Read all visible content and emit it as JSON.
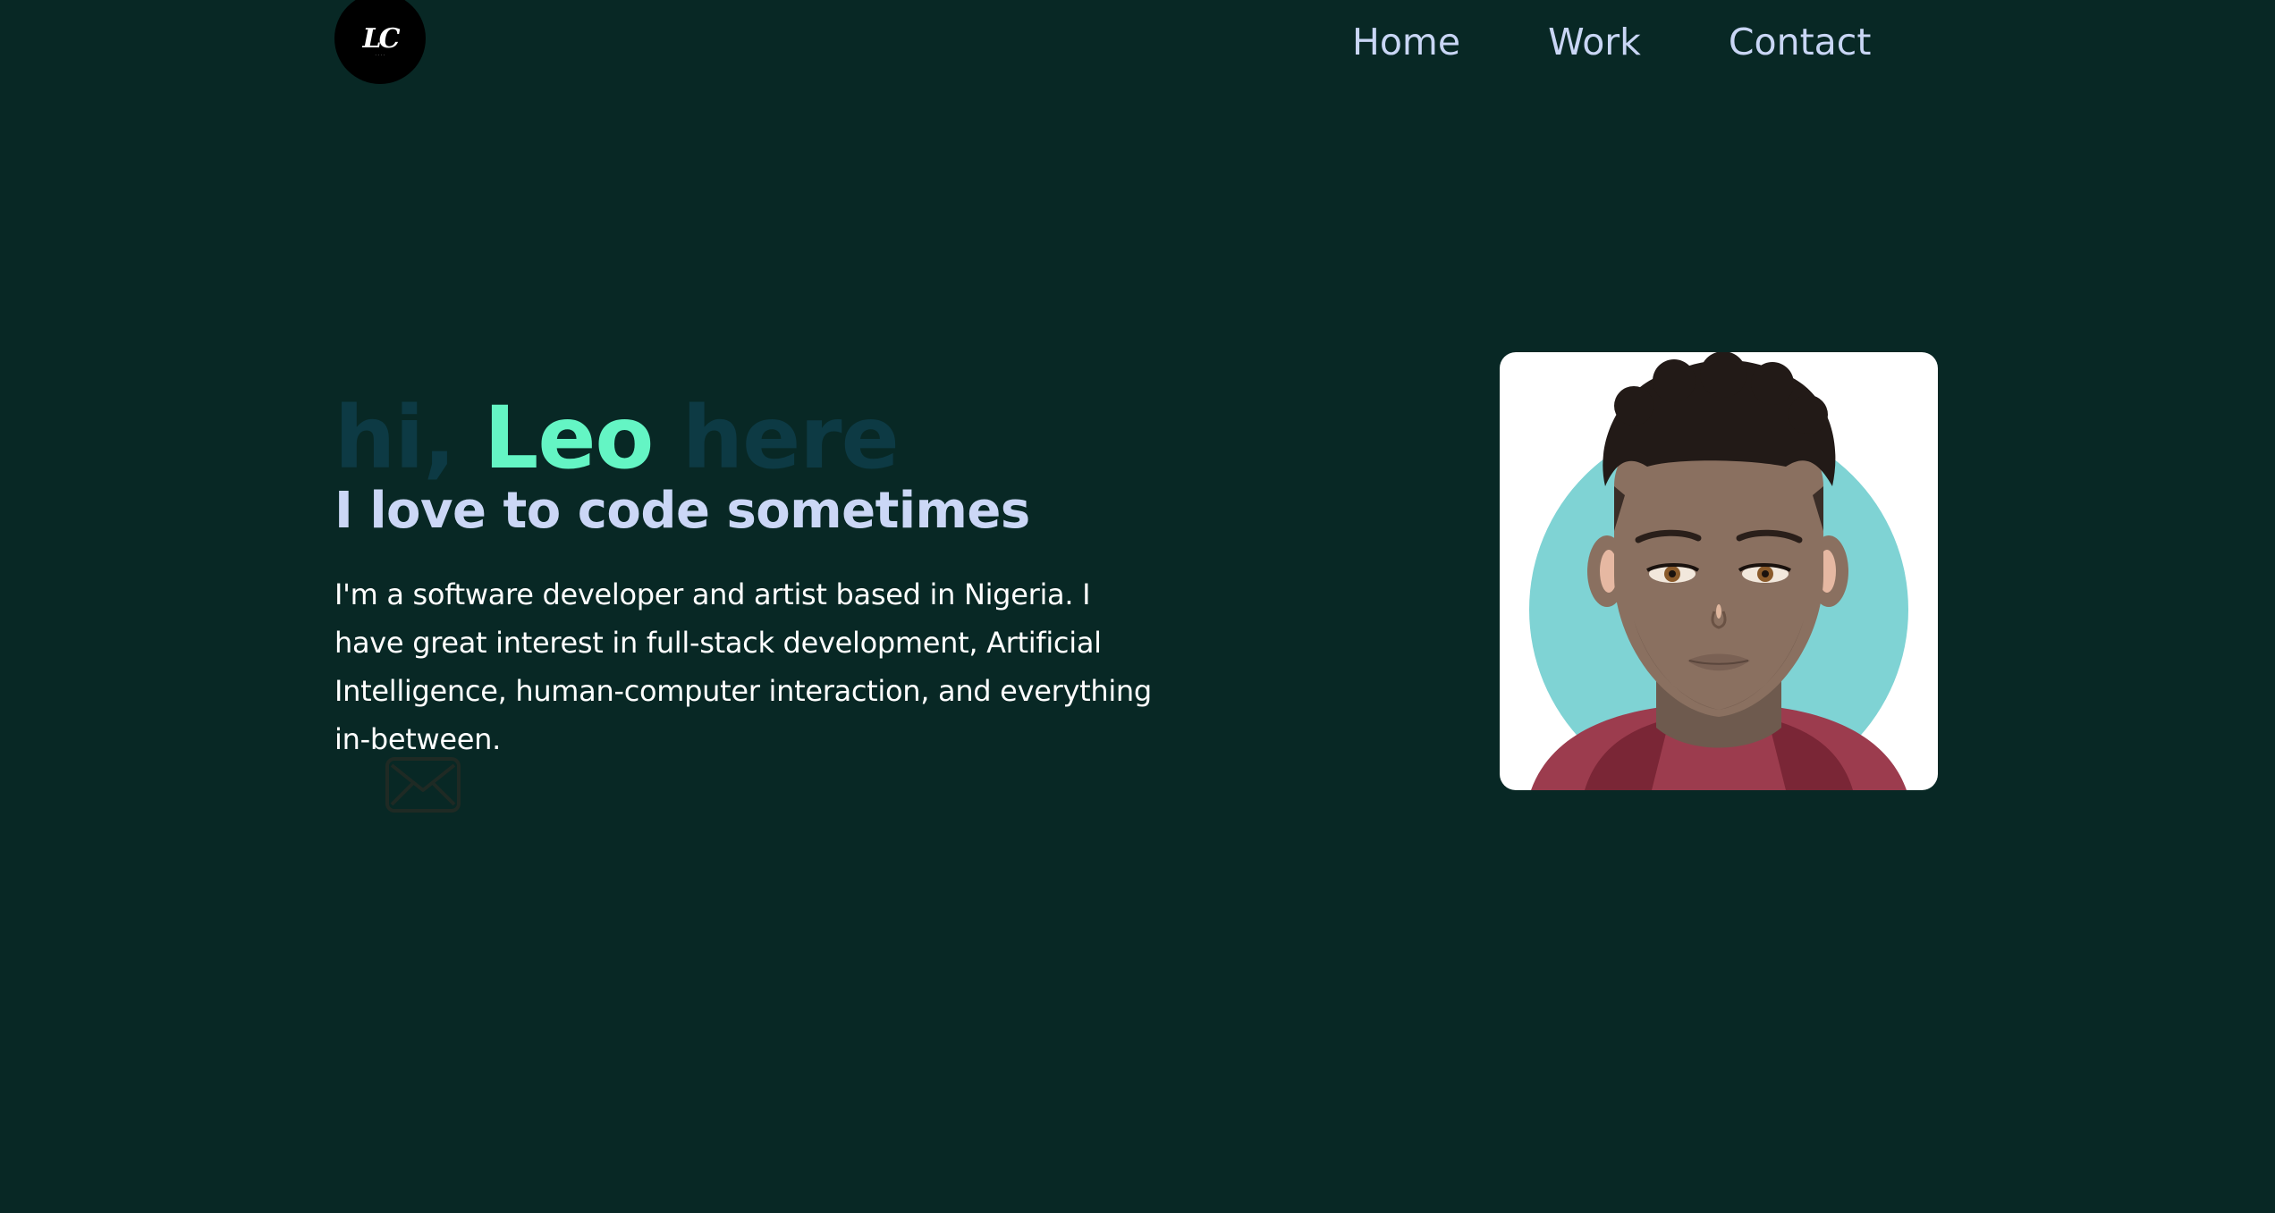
{
  "header": {
    "logo": {
      "mark": "LC",
      "icon": "logo-mark"
    },
    "nav": [
      {
        "label": "Home"
      },
      {
        "label": "Work"
      },
      {
        "label": "Contact"
      }
    ]
  },
  "hero": {
    "greeting_prefix": "hi, ",
    "name": "Leo",
    "greeting_suffix": " here",
    "tagline": "I love to code sometimes",
    "description": "I'm a software developer and artist based in Nigeria. I have great interest in full-stack development, Artificial Intelligence, human-computer interaction, and everything in-between.",
    "contact_icon": "envelope-icon"
  },
  "avatar": {
    "icon": "avatar-illustration"
  },
  "colors": {
    "background": "#082825",
    "accent": "#64f5c4",
    "dim_text": "#0d3a44",
    "nav_text": "#c9d6f5",
    "tagline": "#cbd7f6",
    "body_text": "#ffffff",
    "avatar_circle": "#7fd3d4",
    "hoodie": "#9c3c4e"
  }
}
